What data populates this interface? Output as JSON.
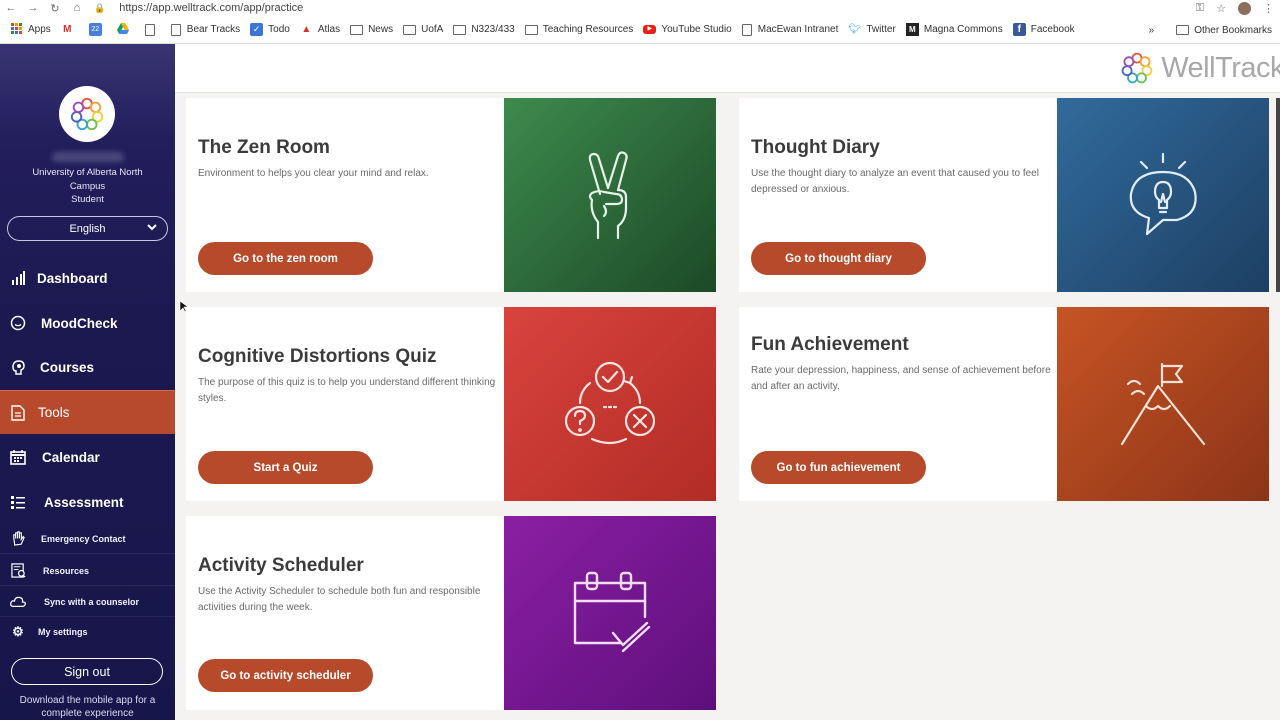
{
  "browser": {
    "url": "https://app.welltrack.com/app/practice",
    "bookmarks": [
      {
        "label": "Apps",
        "icon": "apps-grid-icon"
      },
      {
        "label": "",
        "icon": "gmail-icon"
      },
      {
        "label": "",
        "icon": "calendar-icon"
      },
      {
        "label": "",
        "icon": "drive-icon"
      },
      {
        "label": "",
        "icon": "page-icon"
      },
      {
        "label": "Bear Tracks",
        "icon": "page-icon"
      },
      {
        "label": "Todo",
        "icon": "checkbox-icon"
      },
      {
        "label": "Atlas",
        "icon": "atlas-icon"
      },
      {
        "label": "News",
        "icon": "folder-icon"
      },
      {
        "label": "UofA",
        "icon": "folder-icon"
      },
      {
        "label": "N323/433",
        "icon": "folder-icon"
      },
      {
        "label": "Teaching Resources",
        "icon": "folder-icon"
      },
      {
        "label": "YouTube Studio",
        "icon": "youtube-icon"
      },
      {
        "label": "MacEwan Intranet",
        "icon": "page-icon"
      },
      {
        "label": "Twitter",
        "icon": "twitter-icon"
      },
      {
        "label": "Magna Commons",
        "icon": "magna-icon"
      },
      {
        "label": "Facebook",
        "icon": "facebook-icon"
      }
    ],
    "more": "»",
    "other_bookmarks": "Other Bookmarks"
  },
  "sidebar": {
    "university": "University of Alberta North Campus",
    "role": "Student",
    "language": "English",
    "nav": [
      {
        "label": "Dashboard",
        "icon": "bar-chart-icon"
      },
      {
        "label": "MoodCheck",
        "icon": "smiley-icon"
      },
      {
        "label": "Courses",
        "icon": "brain-icon"
      },
      {
        "label": "Tools",
        "icon": "document-icon"
      },
      {
        "label": "Calendar",
        "icon": "calendar-icon"
      },
      {
        "label": "Assessment",
        "icon": "checklist-icon"
      }
    ],
    "sub": [
      {
        "label": "Emergency Contact",
        "icon": "hand-icon"
      },
      {
        "label": "Resources",
        "icon": "resources-icon"
      },
      {
        "label": "Sync with a counselor",
        "icon": "cloud-icon"
      },
      {
        "label": "My settings",
        "icon": "gear-icon"
      }
    ],
    "signout": "Sign out",
    "mobile_note": "Download the mobile app for a complete experience"
  },
  "header": {
    "brand": "WellTrack"
  },
  "cards": [
    {
      "title": "The Zen Room",
      "desc": "Environment to helps you clear your mind and relax.",
      "button": "Go to the zen room",
      "icon": "peace-hand-icon",
      "color_from": "#3d8a4e",
      "color_to": "#1c4a26"
    },
    {
      "title": "Thought Diary",
      "desc": "Use the thought diary to analyze an event that caused you to feel depressed or anxious.",
      "button": "Go to thought diary",
      "icon": "lightbulb-speech-icon",
      "color_from": "#316b9c",
      "color_to": "#1d3f63"
    },
    {
      "title": "Cognitive Distortions Quiz",
      "desc": "The purpose of this quiz is to help you understand different thinking styles.",
      "button": "Start a Quiz",
      "icon": "quiz-cycle-icon",
      "color_from": "#d9433e",
      "color_to": "#b22c25"
    },
    {
      "title": "Fun Achievement",
      "desc": "Rate your depression, happiness, and sense of achievement before and after an activity.",
      "button": "Go to fun achievement",
      "icon": "mountain-flag-icon",
      "color_from": "#c65424",
      "color_to": "#8d3418"
    },
    {
      "title": "Activity Scheduler",
      "desc": "Use the Activity Scheduler to schedule both fun and responsible activities during the week.",
      "button": "Go to activity scheduler",
      "icon": "calendar-check-icon",
      "color_from": "#8b1fa3",
      "color_to": "#5e0f7c"
    }
  ],
  "colors": {
    "accent": "#b84a2c",
    "sidebar": "#1c1951",
    "active_nav": "#b74a2d"
  }
}
